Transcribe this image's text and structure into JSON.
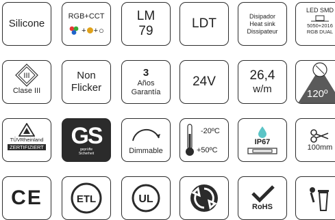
{
  "tiles": {
    "silicone": {
      "label": "Silicone"
    },
    "rgbcct": {
      "label": "RGB+CCT",
      "plus1": "+",
      "plus2": "+",
      "ring": "○"
    },
    "lm79": {
      "line1": "LM",
      "line2": "79"
    },
    "ldt": {
      "label": "LDT"
    },
    "heatsink": {
      "line1": "Disipador",
      "line2": "Heat sink",
      "line3": "Dissipateur"
    },
    "ledsmd": {
      "line1": "LED SMD",
      "line2": "5050+2016",
      "line3": "RGB DUAL"
    },
    "clase": {
      "label": "Clase III",
      "symbol": "III"
    },
    "flicker": {
      "line1": "Non",
      "line2": "Flicker"
    },
    "warranty": {
      "number": "3",
      "line1": "Años",
      "line2": "Garantía"
    },
    "voltage": {
      "label": "24V"
    },
    "power": {
      "line1": "26,4",
      "line2": "w/m"
    },
    "angle": {
      "label": "120º"
    },
    "tuv": {
      "line1": "TÜVRheinland",
      "line2": "ZERTIFIZIERT"
    },
    "gs": {
      "letters": "GS",
      "caption1": "geprüfte",
      "caption2": "Sicherheit"
    },
    "dimmable": {
      "label": "Dimmable"
    },
    "temperature": {
      "high": "-20ºC",
      "low": "+50ºC"
    },
    "ip": {
      "label": "IP67"
    },
    "cut": {
      "label": "100mm"
    },
    "ce": {
      "label": "CE"
    },
    "etl": {
      "label": "ETL"
    },
    "ul": {
      "label": "UL"
    },
    "recycle": {},
    "rohs": {
      "label": "RoHS"
    },
    "bin": {}
  },
  "colors": {
    "stroke": "#2b2b2b",
    "red": "#e53935",
    "blue": "#1e63c9",
    "green": "#3aa935",
    "orange": "#e0a21a",
    "teal": "#5bc4c6",
    "gray": "#5a5a5a"
  }
}
